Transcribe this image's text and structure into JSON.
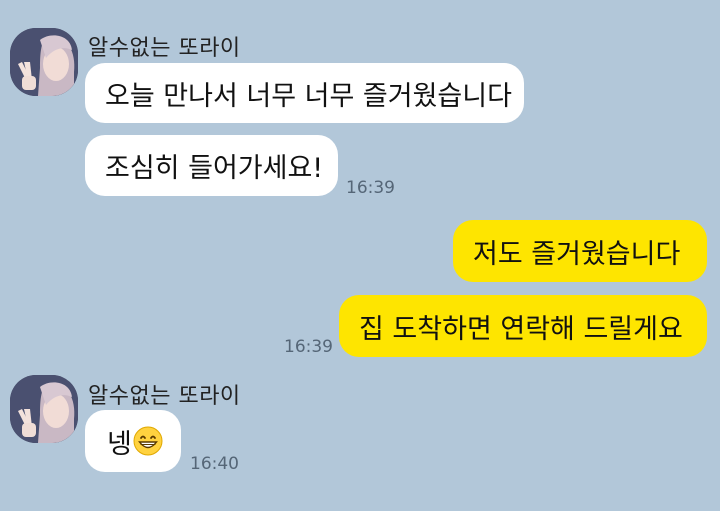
{
  "conversation": {
    "groups": [
      {
        "sender": "알수없는 또라이",
        "messages": [
          {
            "text": "오늘 만나서 너무 너무 즐거웠습니다"
          },
          {
            "text": "조심히 들어가세요!",
            "time": "16:39"
          }
        ]
      },
      {
        "sender": "me",
        "messages": [
          {
            "text": "저도 즐거웠습니다"
          },
          {
            "text": "집 도착하면 연락해 드릴게요",
            "time": "16:39"
          }
        ]
      },
      {
        "sender": "알수없는 또라이",
        "messages": [
          {
            "text": "넹",
            "emoji": "grinning-face-emoji",
            "time": "16:40"
          }
        ]
      }
    ]
  },
  "colors": {
    "background": "#b2c7d9",
    "incoming_bubble": "#ffffff",
    "outgoing_bubble": "#fee500",
    "timestamp": "#556677"
  }
}
